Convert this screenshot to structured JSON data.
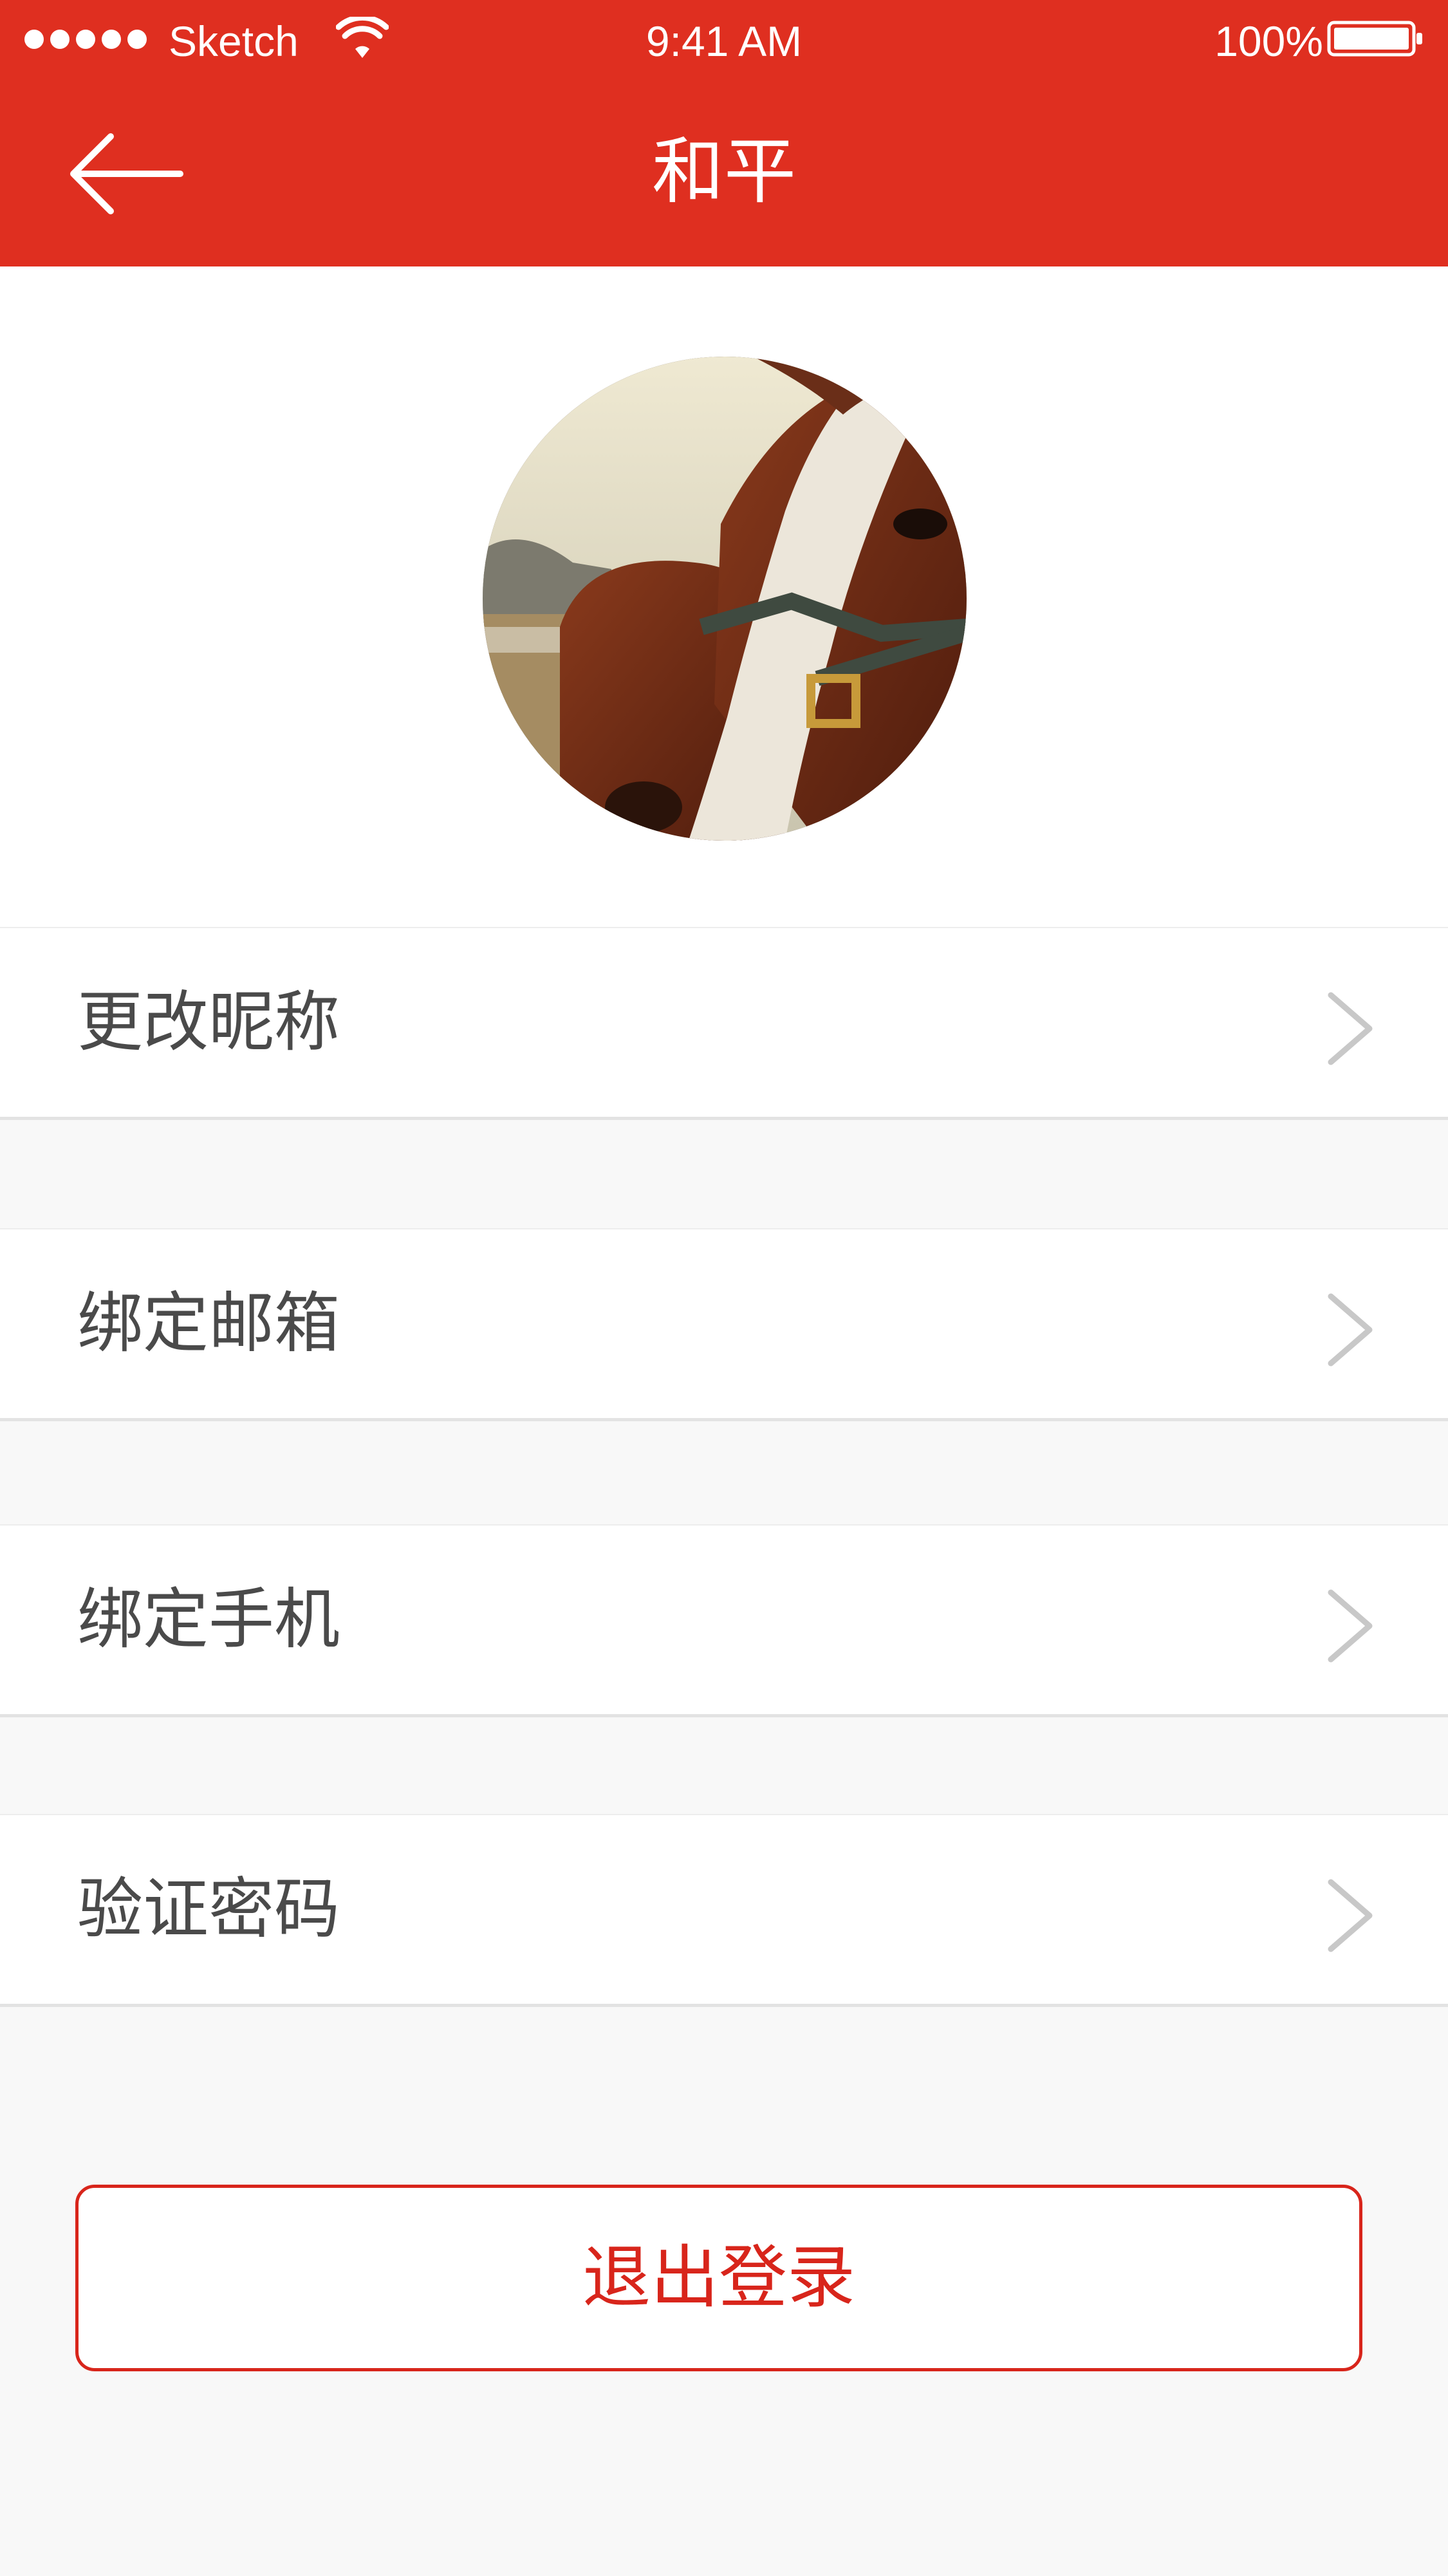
{
  "colors": {
    "brand_red": "#df2f20",
    "logout_red": "#d8251b",
    "background": "#f8f8f8",
    "row_text": "#4a4a4a",
    "chevron": "#c8c8c8"
  },
  "status_bar": {
    "carrier": "Sketch",
    "time": "9:41 AM",
    "battery": "100%",
    "icons": [
      "signal-dots-icon",
      "wifi-icon",
      "battery-icon"
    ]
  },
  "nav": {
    "title": "和平",
    "back_icon": "arrow-left-icon"
  },
  "profile": {
    "avatar": "horse-photo"
  },
  "menu": {
    "items": [
      {
        "label": "更改昵称",
        "icon": "chevron-right-icon"
      },
      {
        "label": "绑定邮箱",
        "icon": "chevron-right-icon"
      },
      {
        "label": "绑定手机",
        "icon": "chevron-right-icon"
      },
      {
        "label": "验证密码",
        "icon": "chevron-right-icon"
      }
    ]
  },
  "logout": {
    "label": "退出登录"
  }
}
